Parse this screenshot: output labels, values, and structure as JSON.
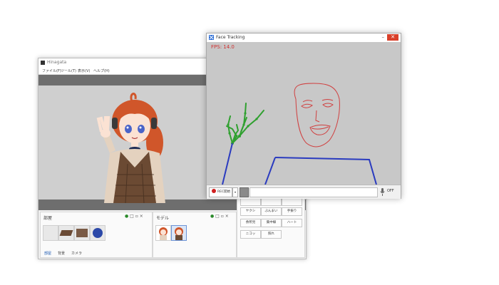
{
  "main_window": {
    "title": "Hinagata",
    "menu": [
      "ファイル(F)",
      "ツール(T)",
      "表示(V)",
      "ヘルプ(H)"
    ],
    "room_panel": {
      "title": "部屋",
      "tabs": [
        "部屋",
        "背景",
        "カメラ"
      ]
    },
    "model_panel": {
      "title": "モデル"
    },
    "pose_buttons": {
      "row0": [
        "",
        "",
        ""
      ],
      "row1": [
        "ヤクシ",
        "ぶんまい",
        "手振り"
      ],
      "row2": [
        "余所見",
        "集中線",
        "ハート"
      ],
      "row3": [
        "ニコッ",
        "照れ"
      ]
    }
  },
  "face_window": {
    "title": "Face Tracking",
    "fps_label": "FPS: 14.0",
    "close_glyph": "✕",
    "minimize_glyph": "–",
    "rec_label": "REC開始",
    "off_label": "OFF"
  },
  "colors": {
    "face_outline": "#d04040",
    "hand_outline": "#2fa02f",
    "body_outline": "#2a3bbf",
    "fps_text": "#d03030"
  }
}
